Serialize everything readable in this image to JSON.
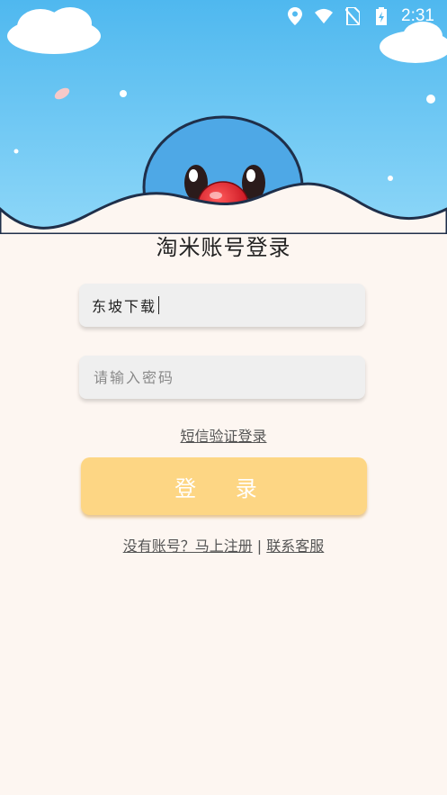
{
  "status_bar": {
    "time": "2:31",
    "icons": [
      "location-icon",
      "wifi-icon",
      "no-sim-icon",
      "battery-charging-icon"
    ]
  },
  "page": {
    "title": "淘米账号登录"
  },
  "form": {
    "account_value": "东坡下载",
    "password_placeholder": "请输入密码",
    "sms_login_label": "短信验证登录",
    "login_button_label": "登 录"
  },
  "footer": {
    "register_label": "没有账号？马上注册",
    "separator": "|",
    "contact_label": "联系客服"
  },
  "colors": {
    "sky": "#5cc0f2",
    "background": "#fdf6f1",
    "button": "#fdd684",
    "mascot_body": "#4ea8e6",
    "mascot_nose": "#e01e2a"
  }
}
